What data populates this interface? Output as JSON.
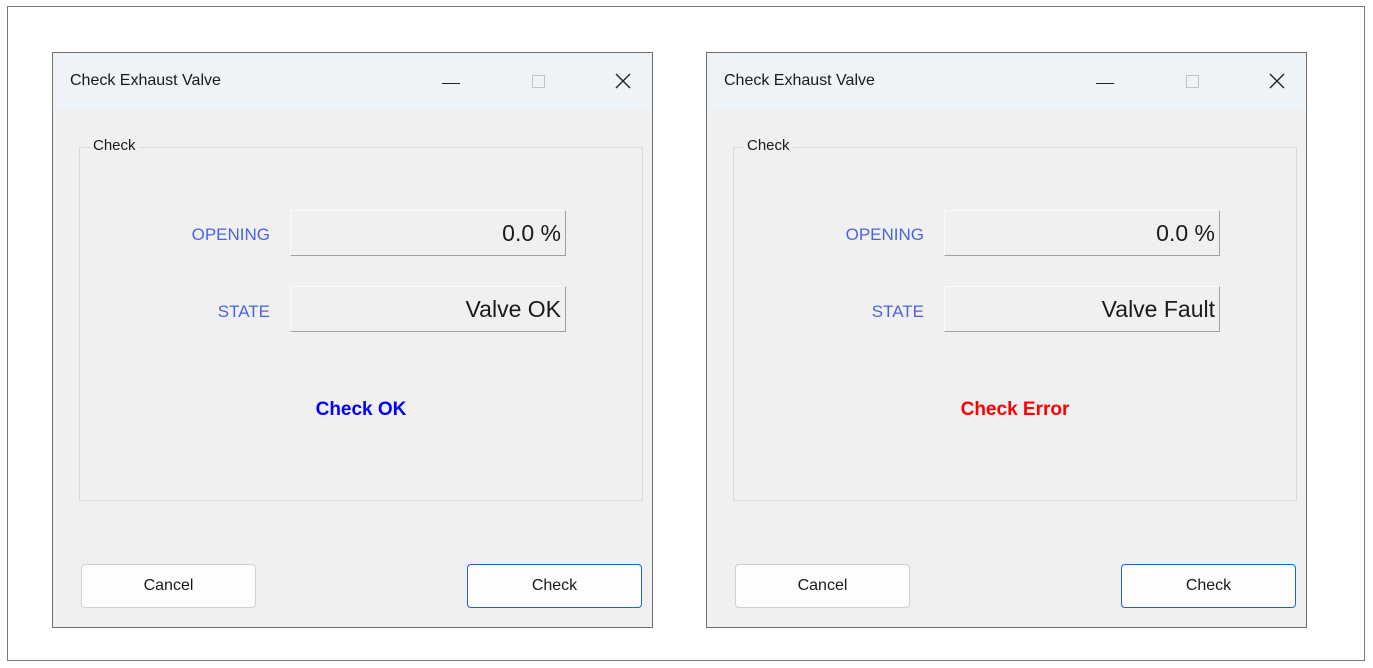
{
  "windows": [
    {
      "title": "Check Exhaust Valve",
      "group_title": "Check",
      "opening_label": "OPENING",
      "opening_value": "0.0 %",
      "state_label": "STATE",
      "state_value": "Valve OK",
      "result_text": "Check OK",
      "result_color": "#0000ff",
      "cancel_label": "Cancel",
      "check_label": "Check"
    },
    {
      "title": "Check Exhaust Valve",
      "group_title": "Check",
      "opening_label": "OPENING",
      "opening_value": "0.0 %",
      "state_label": "STATE",
      "state_value": "Valve Fault",
      "result_text": "Check Error",
      "result_color": "#ff0000",
      "cancel_label": "Cancel",
      "check_label": "Check"
    }
  ],
  "icons": {
    "minimize": "minimize-icon",
    "maximize": "maximize-icon",
    "close": "close-icon"
  }
}
